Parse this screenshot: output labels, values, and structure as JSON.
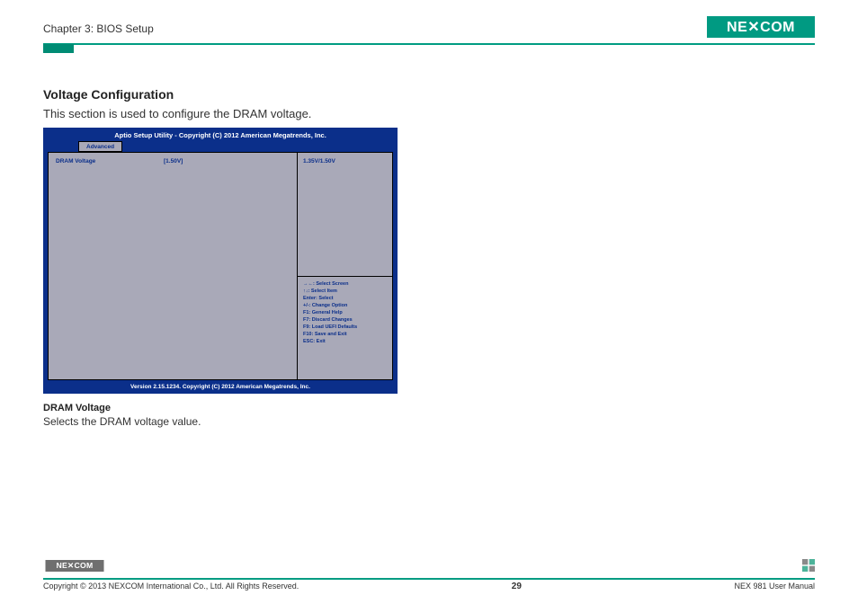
{
  "header": {
    "chapter": "Chapter 3: BIOS Setup",
    "brand": "NEXCOM"
  },
  "section": {
    "heading": "Voltage Configuration",
    "description": "This section is used to configure the DRAM voltage."
  },
  "bios": {
    "title": "Aptio Setup Utility - Copyright (C) 2012 American Megatrends, Inc.",
    "tab": "Advanced",
    "setting": {
      "name": "DRAM Voltage",
      "value": "[1.50V]"
    },
    "help": "1.35V/1.50V",
    "keys": [
      "→←: Select Screen",
      "↑↓: Select Item",
      "Enter: Select",
      "+/-: Change Option",
      "F1: General Help",
      "F7: Discard Changes",
      "F9: Load UEFI Defaults",
      "F10: Save and Exit",
      "ESC: Exit"
    ],
    "footer": "Version 2.15.1234. Copyright (C) 2012 American Megatrends, Inc."
  },
  "item": {
    "heading": "DRAM Voltage",
    "desc": "Selects the DRAM voltage value."
  },
  "footer": {
    "copyright": "Copyright © 2013 NEXCOM International Co., Ltd. All Rights Reserved.",
    "page": "29",
    "manual": "NEX 981 User Manual"
  }
}
